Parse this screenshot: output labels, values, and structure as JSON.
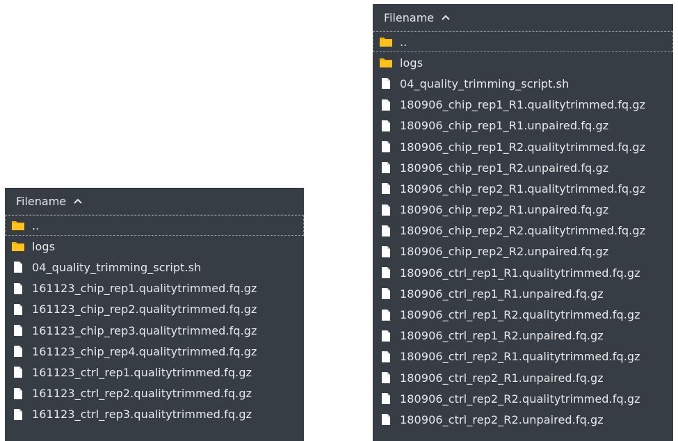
{
  "left_panel": {
    "header": {
      "label": "Filename"
    },
    "items": [
      {
        "name": "..",
        "type": "folder"
      },
      {
        "name": "logs",
        "type": "folder"
      },
      {
        "name": "04_quality_trimming_script.sh",
        "type": "file"
      },
      {
        "name": "161123_chip_rep1.qualitytrimmed.fq.gz",
        "type": "file"
      },
      {
        "name": "161123_chip_rep2.qualitytrimmed.fq.gz",
        "type": "file"
      },
      {
        "name": "161123_chip_rep3.qualitytrimmed.fq.gz",
        "type": "file"
      },
      {
        "name": "161123_chip_rep4.qualitytrimmed.fq.gz",
        "type": "file"
      },
      {
        "name": "161123_ctrl_rep1.qualitytrimmed.fq.gz",
        "type": "file"
      },
      {
        "name": "161123_ctrl_rep2.qualitytrimmed.fq.gz",
        "type": "file"
      },
      {
        "name": "161123_ctrl_rep3.qualitytrimmed.fq.gz",
        "type": "file"
      }
    ]
  },
  "right_panel": {
    "header": {
      "label": "Filename"
    },
    "items": [
      {
        "name": "..",
        "type": "folder"
      },
      {
        "name": "logs",
        "type": "folder"
      },
      {
        "name": "04_quality_trimming_script.sh",
        "type": "file"
      },
      {
        "name": "180906_chip_rep1_R1.qualitytrimmed.fq.gz",
        "type": "file"
      },
      {
        "name": "180906_chip_rep1_R1.unpaired.fq.gz",
        "type": "file"
      },
      {
        "name": "180906_chip_rep1_R2.qualitytrimmed.fq.gz",
        "type": "file"
      },
      {
        "name": "180906_chip_rep1_R2.unpaired.fq.gz",
        "type": "file"
      },
      {
        "name": "180906_chip_rep2_R1.qualitytrimmed.fq.gz",
        "type": "file"
      },
      {
        "name": "180906_chip_rep2_R1.unpaired.fq.gz",
        "type": "file"
      },
      {
        "name": "180906_chip_rep2_R2.qualitytrimmed.fq.gz",
        "type": "file"
      },
      {
        "name": "180906_chip_rep2_R2.unpaired.fq.gz",
        "type": "file"
      },
      {
        "name": "180906_ctrl_rep1_R1.qualitytrimmed.fq.gz",
        "type": "file"
      },
      {
        "name": "180906_ctrl_rep1_R1.unpaired.fq.gz",
        "type": "file"
      },
      {
        "name": "180906_ctrl_rep1_R2.qualitytrimmed.fq.gz",
        "type": "file"
      },
      {
        "name": "180906_ctrl_rep1_R2.unpaired.fq.gz",
        "type": "file"
      },
      {
        "name": "180906_ctrl_rep2_R1.qualitytrimmed.fq.gz",
        "type": "file"
      },
      {
        "name": "180906_ctrl_rep2_R1.unpaired.fq.gz",
        "type": "file"
      },
      {
        "name": "180906_ctrl_rep2_R2.qualitytrimmed.fq.gz",
        "type": "file"
      },
      {
        "name": "180906_ctrl_rep2_R2.unpaired.fq.gz",
        "type": "file"
      }
    ]
  },
  "colors": {
    "panel_bg": "#373d45",
    "text": "#e6e9ec",
    "folder": "#f5b400",
    "file": "#ffffff"
  },
  "icons": {
    "folder": "folder-icon",
    "file": "file-icon",
    "sort": "chevron-up-icon"
  }
}
